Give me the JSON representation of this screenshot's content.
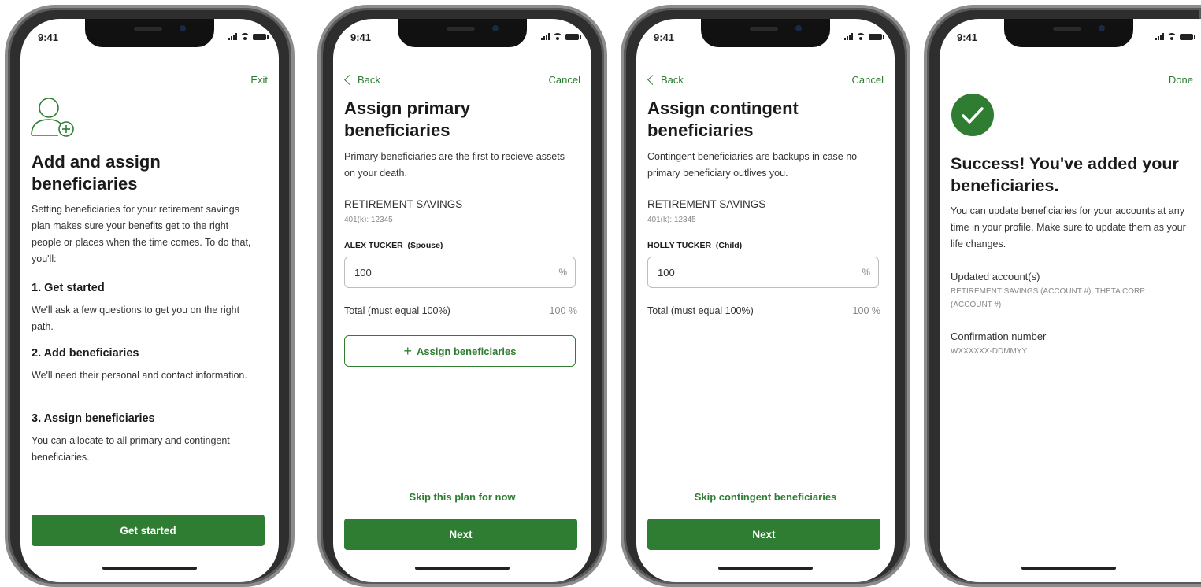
{
  "status": {
    "time": "9:41"
  },
  "screen1": {
    "nav_right": "Exit",
    "title": "Add and assign beneficiaries",
    "intro": "Setting beneficiaries for your retirement savings plan makes sure your benefits get to the right people or places when the time comes. To do that, you'll:",
    "steps": [
      {
        "title": "1. Get started",
        "desc": "We'll ask a few questions to get you on the right path."
      },
      {
        "title": "2. Add beneficiaries",
        "desc": "We'll need their personal and contact information."
      },
      {
        "title": "3. Assign beneficiaries",
        "desc": "You can allocate to all primary and contingent beneficiaries."
      }
    ],
    "cta": "Get started",
    "icon": "add-person-icon"
  },
  "screen2": {
    "nav_left": "Back",
    "nav_right": "Cancel",
    "title": "Assign primary beneficiaries",
    "desc": "Primary beneficiaries are the first to recieve assets on your death.",
    "plan_name": "RETIREMENT SAVINGS",
    "plan_id": "401(k): 12345",
    "beneficiary": "ALEX TUCKER  (Spouse)",
    "value": "100",
    "unit": "%",
    "total_label": "Total (must equal 100%)",
    "total_value": "100 %",
    "assign_button": "Assign beneficiaries",
    "skip": "Skip this plan for now",
    "cta": "Next"
  },
  "screen3": {
    "nav_left": "Back",
    "nav_right": "Cancel",
    "title": "Assign contingent beneficiaries",
    "desc": "Contingent beneficiaries are backups in case no primary beneficiary outlives you.",
    "plan_name": "RETIREMENT SAVINGS",
    "plan_id": "401(k): 12345",
    "beneficiary": "HOLLY TUCKER  (Child)",
    "value": "100",
    "unit": "%",
    "total_label": "Total (must equal 100%)",
    "total_value": "100 %",
    "skip": "Skip contingent beneficiaries",
    "cta": "Next"
  },
  "screen4": {
    "nav_right": "Done",
    "title": "Success! You've added your beneficiaries.",
    "desc": "You can update beneficiaries for your accounts at any time in your profile. Make sure to update them as your life changes.",
    "updated_label": "Updated account(s)",
    "updated_value": "RETIREMENT SAVINGS (ACCOUNT #), THETA CORP (ACCOUNT #)",
    "confirmation_label": "Confirmation number",
    "confirmation_value": "WXXXXXX-DDMMYY",
    "icon": "checkmark-circle-icon"
  },
  "colors": {
    "accent": "#2e7d32",
    "text": "#1a1a1a",
    "muted": "#888888"
  }
}
